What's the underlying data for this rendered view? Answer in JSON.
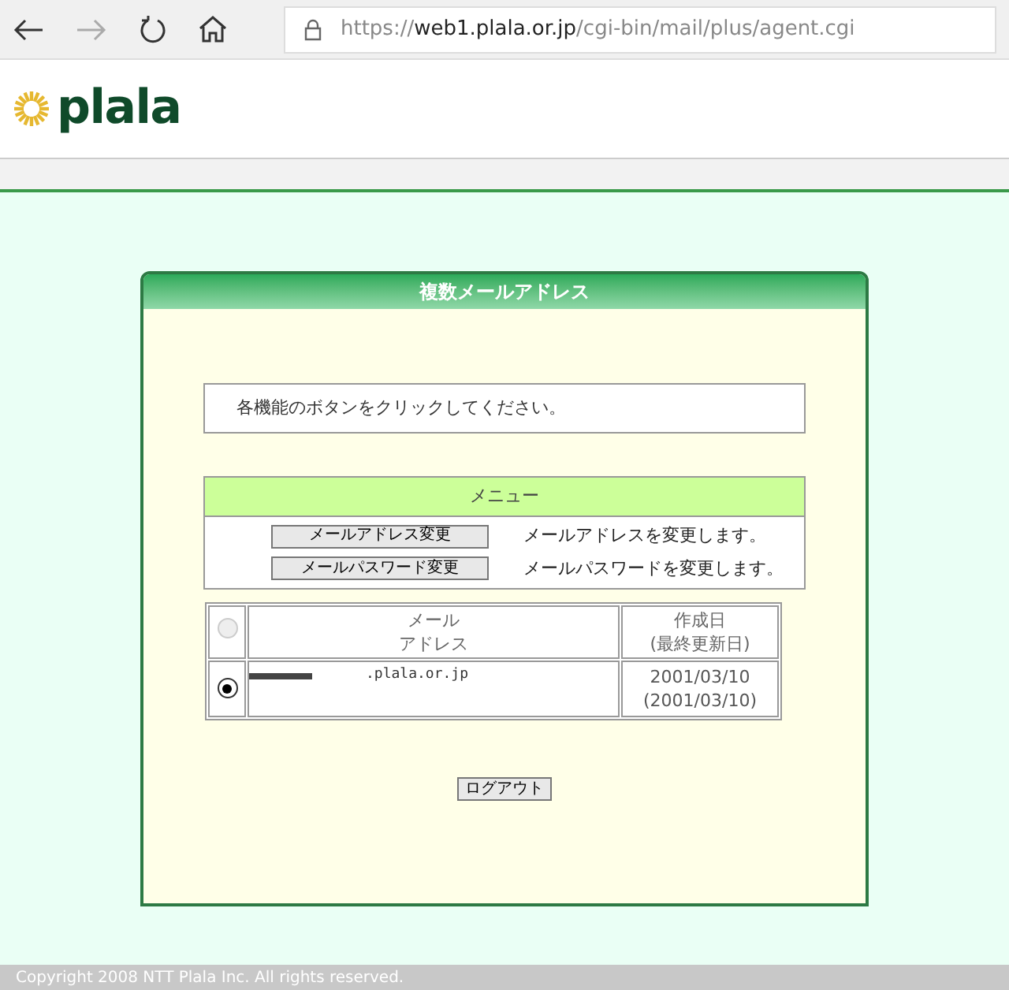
{
  "browser": {
    "url_scheme": "https://",
    "url_host": "web1.plala.or.jp",
    "url_path": "/cgi-bin/mail/plus/agent.cgi",
    "forward_disabled": true
  },
  "logo": {
    "text": "plala"
  },
  "panel": {
    "title": "複数メールアドレス",
    "message": "各機能のボタンをクリックしてください。"
  },
  "menu": {
    "title": "メニュー",
    "items": [
      {
        "button": "メールアドレス変更",
        "description": "メールアドレスを変更します。"
      },
      {
        "button": "メールパスワード変更",
        "description": "メールパスワードを変更します。"
      }
    ]
  },
  "table": {
    "header_radio": {
      "selected": false,
      "disabled": true
    },
    "columns": [
      [
        "メール",
        "アドレス"
      ],
      [
        "作成日",
        "(最終更新日)"
      ]
    ],
    "rows": [
      {
        "selected": true,
        "address": ".plala.or.jp",
        "redacted": true,
        "created": "2001/03/10",
        "updated": "(2001/03/10)"
      }
    ]
  },
  "logout": "ログアウト",
  "footer": "Copyright 2008 NTT Plala Inc. All rights reserved."
}
